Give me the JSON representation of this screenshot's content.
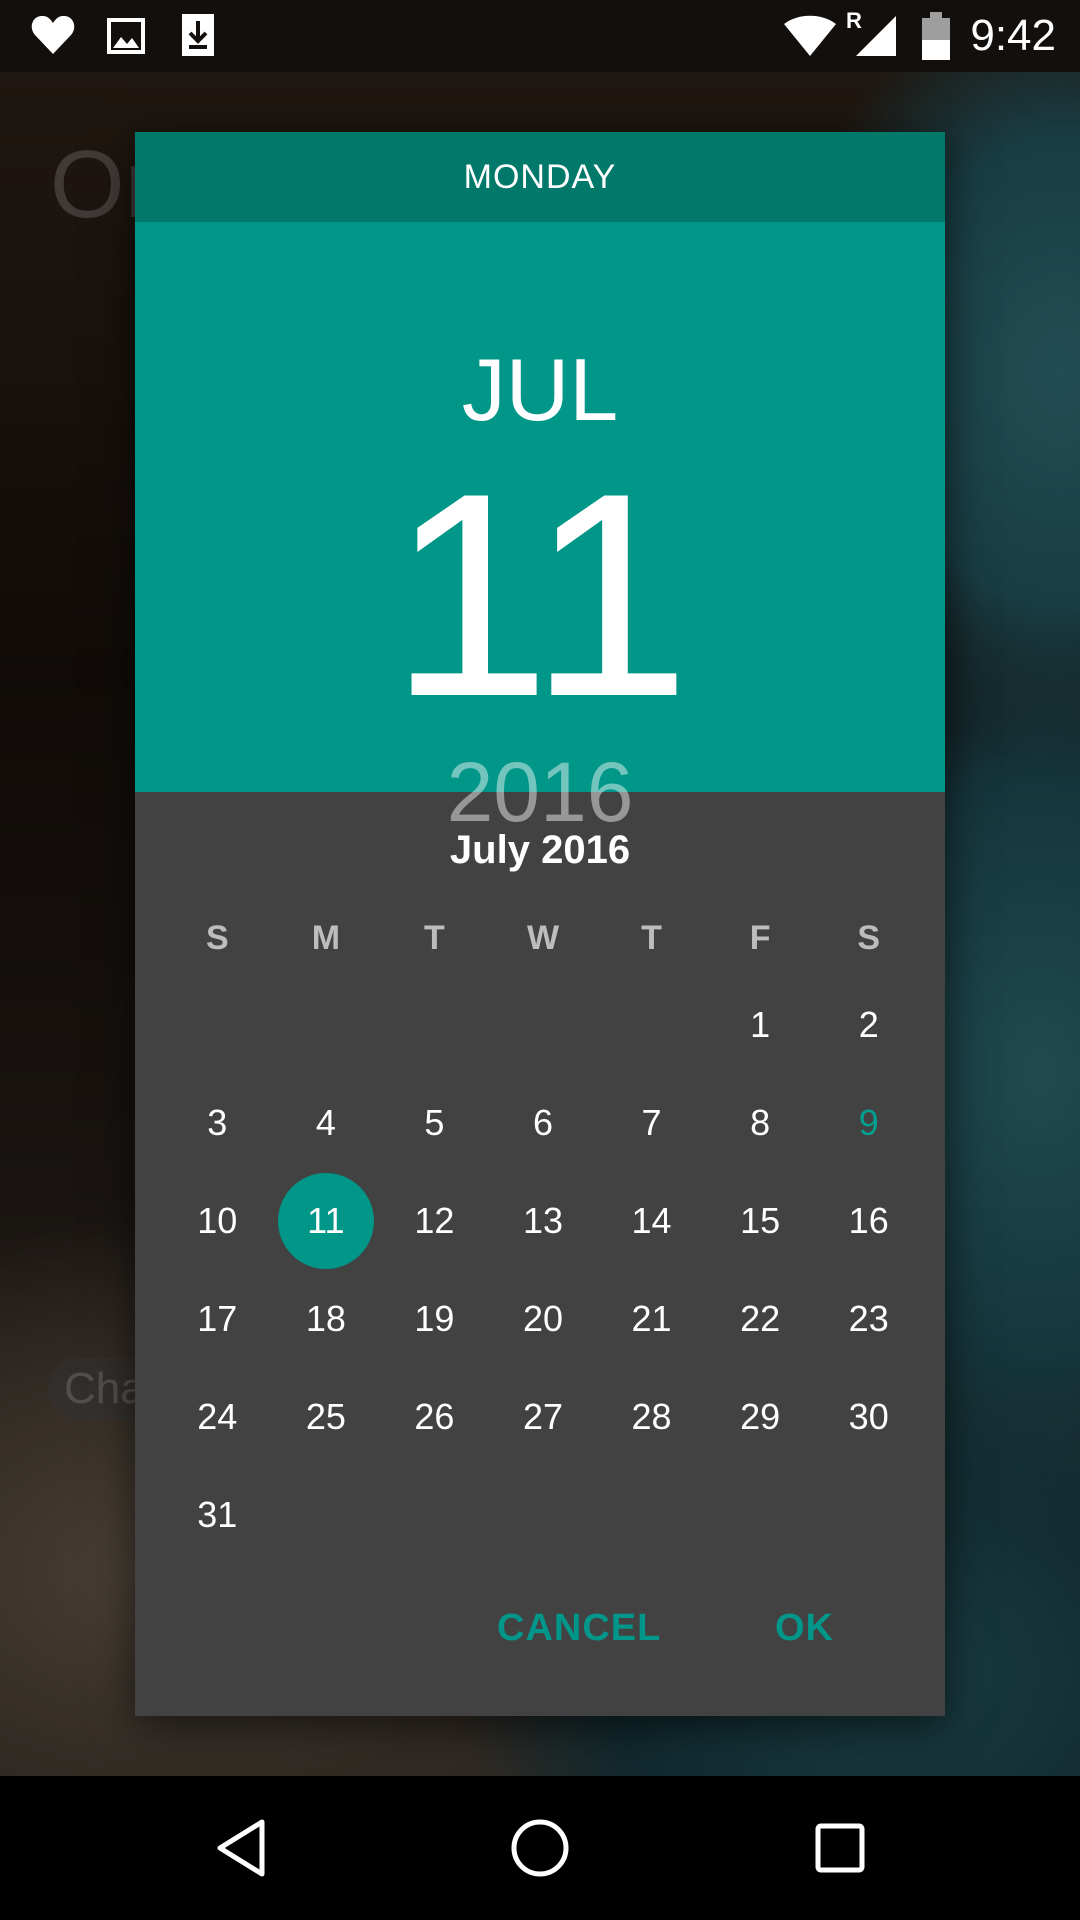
{
  "status_bar": {
    "time": "9:42",
    "left_icons": [
      "heart-icon",
      "image-icon",
      "download-icon"
    ],
    "right_icons": [
      "wifi-icon",
      "roaming-icon",
      "signal-icon",
      "battery-icon"
    ],
    "roaming_label": "R"
  },
  "background_app": {
    "title_fragment": "Or",
    "chip_fragment": "Cha"
  },
  "date_picker": {
    "weekday": "MONDAY",
    "month_short": "JUL",
    "day": "11",
    "year": "2016",
    "month_title": "July 2016",
    "weekday_initials": [
      "S",
      "M",
      "T",
      "W",
      "T",
      "F",
      "S"
    ],
    "leading_blank_days": 5,
    "days": [
      "1",
      "2",
      "3",
      "4",
      "5",
      "6",
      "7",
      "8",
      "9",
      "10",
      "11",
      "12",
      "13",
      "14",
      "15",
      "16",
      "17",
      "18",
      "19",
      "20",
      "21",
      "22",
      "23",
      "24",
      "25",
      "26",
      "27",
      "28",
      "29",
      "30",
      "31"
    ],
    "selected_day": "11",
    "highlighted_day": "9",
    "accent_color": "#009688",
    "header_dark_color": "#00796b",
    "dialog_background": "#424242",
    "cancel_label": "CANCEL",
    "ok_label": "OK"
  },
  "nav_bar": {
    "icons": [
      "back-icon",
      "home-icon",
      "recents-icon"
    ]
  }
}
